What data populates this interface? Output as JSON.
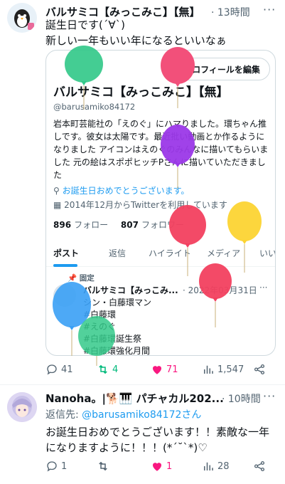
{
  "tweet1": {
    "name": "バルサミコ【みっこみこ】【無】",
    "time": "· 13時間",
    "lines": "誕生日です(´∀`)\n新しい一年もいい年になるといいなぁ",
    "replies": "41",
    "retweets": "4",
    "likes": "71",
    "views": "1,547"
  },
  "card": {
    "edit_label": "プロフィールを編集",
    "name": "バルサミコ【みっこみこ】【無】",
    "handle": "@barusamiko84172",
    "bio": "岩本町芸能社の「えのぐ」にハマりました。環ちゃん推しです。彼女は太陽です。最近批い動画とか作るようになりました アイコンはえのぐのみんなに描いてもらいました 元の絵はスポポヒッチPさんに描いていただきました",
    "birthday": "お誕生日おめでとうございます。",
    "joined": "2014年12月からTwitterを利用しています",
    "following_count": "896",
    "following_label": "フォロー",
    "followers_count": "807",
    "followers_label": "フォロワー",
    "tabs": [
      "ポスト",
      "返信",
      "ハイライト",
      "メディア",
      "いい"
    ],
    "pinned_label": "固定",
    "sub_name": "バルサミコ【みっこみ...",
    "sub_time": "· 2022年03月31日",
    "sub_text": "シン・白藤環マン\n#白藤環\n#えのぐ\n#白藤環誕生祭\n#白藤環強化月間"
  },
  "tweet2": {
    "name": "Nanoha。|🐕🎹 パチャカル202...",
    "time": "· 10時間",
    "reply_prefix": "返信先: ",
    "reply_handle": "@barusamiko84172さん",
    "lines": "お誕生日おめでとうございます！！素敵な一年\nになりますように！！！(*´˘`*)♡",
    "replies": "1",
    "retweets": "",
    "likes": "1",
    "views": "28"
  },
  "colors": {
    "blue": "#1d9bf0",
    "like_pink": "#f91880",
    "retweet_green": "#00ba7c",
    "muted": "#536471"
  },
  "icons": [
    "more-icon",
    "location-icon",
    "calendar-icon",
    "pin-icon",
    "reply-icon",
    "retweet-icon",
    "heart-icon",
    "views-icon",
    "share-icon"
  ]
}
